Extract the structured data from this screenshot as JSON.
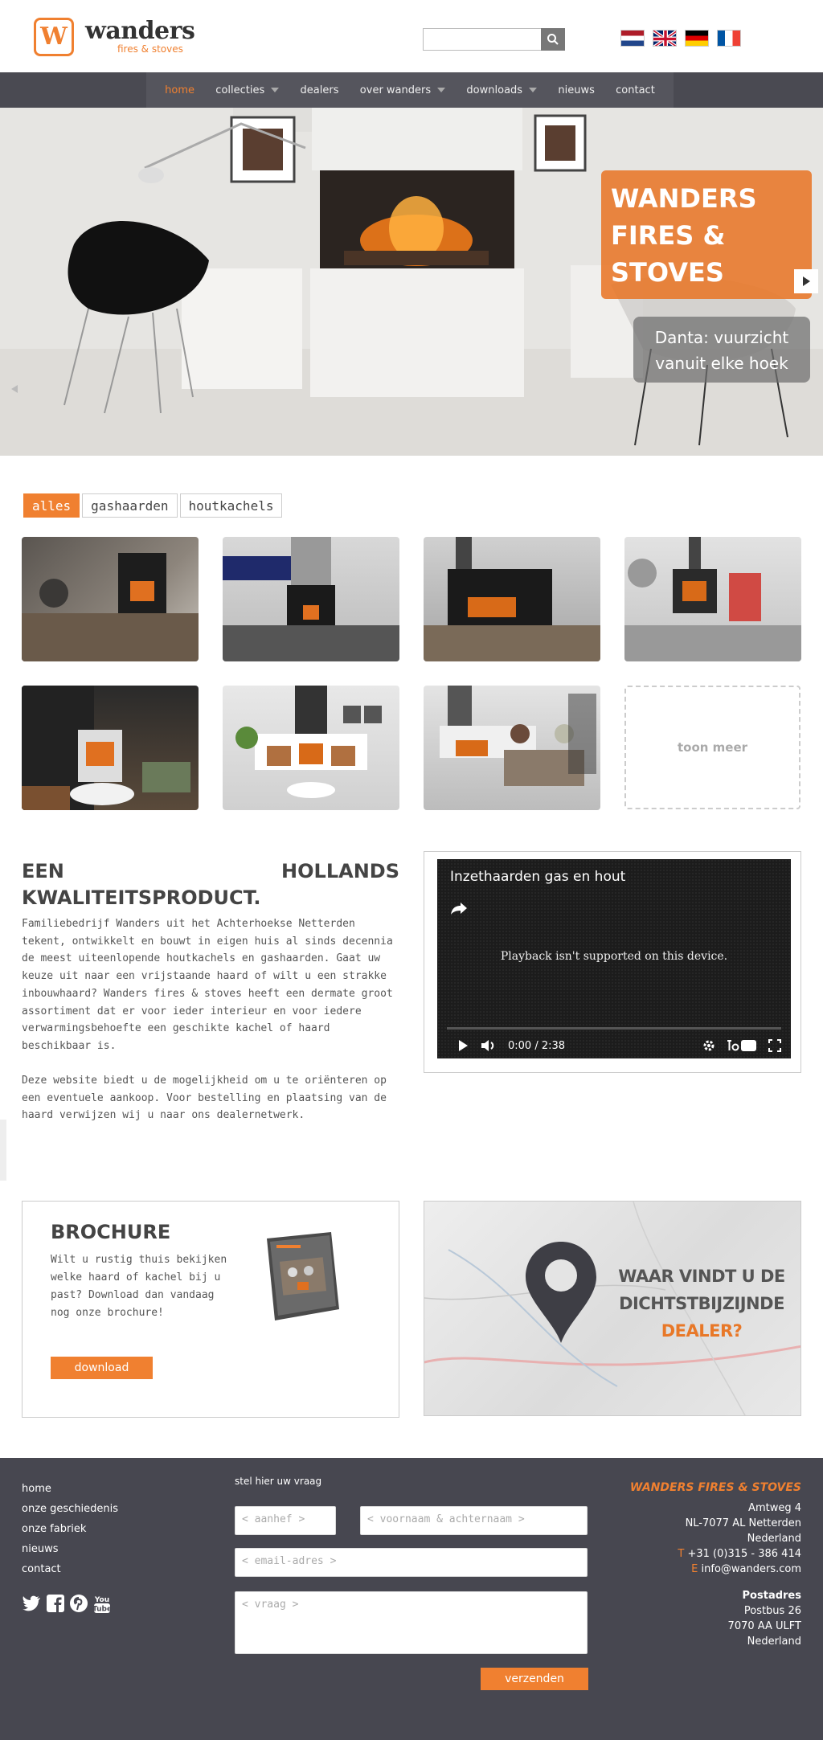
{
  "brand": {
    "name": "wanders",
    "tagline": "fires & stoves",
    "accent": "#f08030"
  },
  "header": {
    "search": {
      "placeholder": "",
      "icon": "search-icon"
    },
    "languages": [
      {
        "code": "nl",
        "icon": "flag-nl-icon"
      },
      {
        "code": "en",
        "icon": "flag-uk-icon"
      },
      {
        "code": "de",
        "icon": "flag-de-icon"
      },
      {
        "code": "fr",
        "icon": "flag-fr-icon"
      }
    ]
  },
  "nav": {
    "items": [
      {
        "label": "home",
        "active": true,
        "dropdown": false
      },
      {
        "label": "collecties",
        "active": false,
        "dropdown": true
      },
      {
        "label": "dealers",
        "active": false,
        "dropdown": false
      },
      {
        "label": "over wanders",
        "active": false,
        "dropdown": true
      },
      {
        "label": "downloads",
        "active": false,
        "dropdown": true
      },
      {
        "label": "nieuws",
        "active": false,
        "dropdown": false
      },
      {
        "label": "contact",
        "active": false,
        "dropdown": false
      }
    ]
  },
  "hero": {
    "title_lines": [
      "WANDERS",
      "FIRES &",
      "STOVES"
    ],
    "subtitle": "Danta: vuurzicht vanuit elke hoek"
  },
  "filters": {
    "items": [
      "alles",
      "gashaarden",
      "houtkachels"
    ],
    "active": "alles"
  },
  "gallery": {
    "more_label": "toon meer"
  },
  "intro": {
    "title": "EEN HOLLANDS KWALITEITSPRODUCT.",
    "paragraph1": "Familiebedrijf Wanders uit het Achterhoekse Netterden tekent, ontwikkelt en bouwt in eigen huis al sinds decennia de meest uiteenlopende houtkachels en gashaarden. Gaat uw keuze uit naar een vrijstaande haard of wilt u een strakke inbouwhaard? Wanders fires & stoves heeft een dermate groot assortiment dat er voor ieder interieur en voor iedere verwarmingsbehoefte een geschikte kachel of haard beschikbaar is.",
    "paragraph2": "Deze website biedt u de mogelijkheid om u te oriënteren op een eventuele aankoop. Voor bestelling en plaatsing van de haard verwijzen wij u naar ons dealernetwerk."
  },
  "video": {
    "title": "Inzethaarden gas en hout",
    "message": "Playback isn't supported on this device.",
    "time": "0:00 / 2:38"
  },
  "brochure": {
    "title": "BROCHURE",
    "text": "Wilt u rustig thuis bekijken welke haard of kachel bij u past? Download dan vandaag nog onze brochure!",
    "button": "download"
  },
  "dealer": {
    "line1": "WAAR VINDT U DE",
    "line2": "DICHTSTBIJZIJNDE",
    "line3": "DEALER?"
  },
  "footer": {
    "links": [
      "home",
      "onze geschiedenis",
      "onze fabriek",
      "nieuws",
      "contact"
    ],
    "social": [
      "twitter-icon",
      "facebook-icon",
      "pinterest-icon",
      "youtube-icon"
    ],
    "form": {
      "title": "stel hier uw vraag",
      "salutation_placeholder": "< aanhef >",
      "name_placeholder": "< voornaam & achternaam >",
      "email_placeholder": "< email-adres >",
      "question_placeholder": "< vraag >",
      "submit": "verzenden"
    },
    "address": {
      "company": "WANDERS FIRES & STOVES",
      "street": "Amtweg 4",
      "city": "NL-7077 AL Netterden",
      "country": "Nederland",
      "phone_prefix": "T",
      "phone": "+31 (0)315 - 386 414",
      "email_prefix": "E",
      "email": "info@wanders.com",
      "postal_title": "Postadres",
      "postal_box": "Postbus 26",
      "postal_city": "7070 AA ULFT",
      "postal_country": "Nederland"
    }
  }
}
